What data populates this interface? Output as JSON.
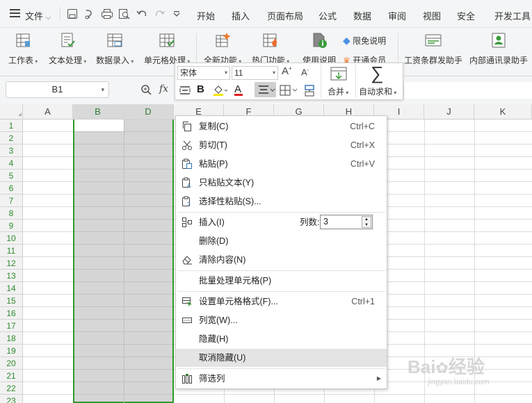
{
  "menubar": {
    "file": "文件",
    "tabs": [
      "开始",
      "插入",
      "页面布局",
      "公式",
      "数据",
      "审阅",
      "视图",
      "安全",
      "开发工具"
    ]
  },
  "toolbar": {
    "items": [
      {
        "label": "工作表",
        "icon": "worksheet-icon"
      },
      {
        "label": "文本处理",
        "icon": "text-process-icon"
      },
      {
        "label": "数据录入",
        "icon": "data-entry-icon"
      },
      {
        "label": "单元格处理",
        "icon": "cell-process-icon"
      },
      {
        "label": "全新功能",
        "icon": "new-features-icon"
      },
      {
        "label": "热门功能",
        "icon": "hot-features-icon"
      },
      {
        "label": "使用说明",
        "icon": "instructions-icon"
      }
    ],
    "free_label": "限免说明",
    "member_label": "开通会员",
    "salary_label": "工资条群发助手",
    "contacts_label": "内部通讯录助手"
  },
  "minibar": {
    "font": "宋体",
    "size": "11",
    "merge": "合并",
    "autosum": "自动求和"
  },
  "formula": {
    "cellref": "B1",
    "fx": "fx"
  },
  "columns": [
    "A",
    "B",
    "D",
    "E",
    "F",
    "G",
    "H",
    "I",
    "J",
    "K"
  ],
  "rows": [
    "1",
    "2",
    "3",
    "4",
    "5",
    "6",
    "7",
    "8",
    "9",
    "10",
    "11",
    "12",
    "13",
    "14",
    "15",
    "16",
    "17",
    "18",
    "19",
    "20",
    "21",
    "22",
    "23"
  ],
  "context_menu": {
    "copy": {
      "label": "复制(C)",
      "shortcut": "Ctrl+C"
    },
    "cut": {
      "label": "剪切(T)",
      "shortcut": "Ctrl+X"
    },
    "paste": {
      "label": "粘贴(P)",
      "shortcut": "Ctrl+V"
    },
    "paste_text": {
      "label": "只粘贴文本(Y)"
    },
    "paste_special": {
      "label": "选择性粘贴(S)..."
    },
    "insert": {
      "label": "插入(I)",
      "cols_label": "列数:",
      "cols_value": "3"
    },
    "delete": {
      "label": "删除(D)"
    },
    "clear": {
      "label": "清除内容(N)"
    },
    "batch": {
      "label": "批量处理单元格(P)"
    },
    "format": {
      "label": "设置单元格格式(F)...",
      "shortcut": "Ctrl+1"
    },
    "colwidth": {
      "label": "列宽(W)..."
    },
    "hide": {
      "label": "隐藏(H)"
    },
    "unhide": {
      "label": "取消隐藏(U)"
    },
    "filter": {
      "label": "筛选列"
    }
  },
  "watermark": {
    "brand": "Bai",
    "brand2": "经验",
    "url": "jingyan.baidu.com"
  },
  "colors": {
    "accent_green": "#2e9a2e",
    "selection_gray": "#d6d6d6",
    "menu_highlight": "#e4e4e4"
  }
}
